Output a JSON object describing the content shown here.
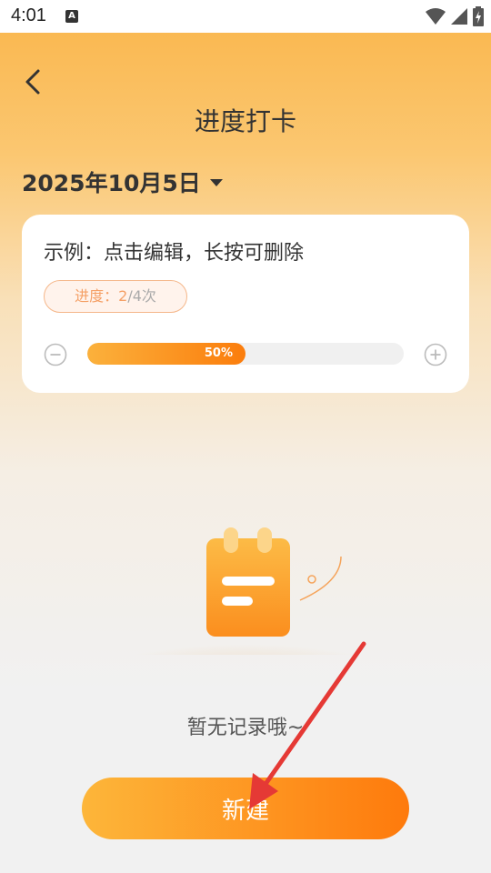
{
  "status_bar": {
    "time": "4:01",
    "notification_badge": "A",
    "icons": [
      "wifi-icon",
      "signal-icon",
      "battery-charging-icon"
    ]
  },
  "header": {
    "title": "进度打卡",
    "back_icon": "chevron-left-icon"
  },
  "date_selector": {
    "date": "2025年10月5日",
    "icon": "caret-down-icon"
  },
  "example_card": {
    "title": "示例：点击编辑，长按可删除",
    "progress_label": "进度：",
    "progress_done": "2",
    "progress_total": "/4次",
    "progress_fraction": 0.5,
    "progress_percent_label": "50%",
    "minus_icon": "minus-circle-icon",
    "plus_icon": "plus-circle-icon"
  },
  "empty_state": {
    "icon": "notebook-icon",
    "message": "暂无记录哦~"
  },
  "footer": {
    "new_button_label": "新建"
  },
  "colors": {
    "accent_start": "#fdb63a",
    "accent_end": "#fe7a0c",
    "annotation_arrow": "#e53935"
  }
}
